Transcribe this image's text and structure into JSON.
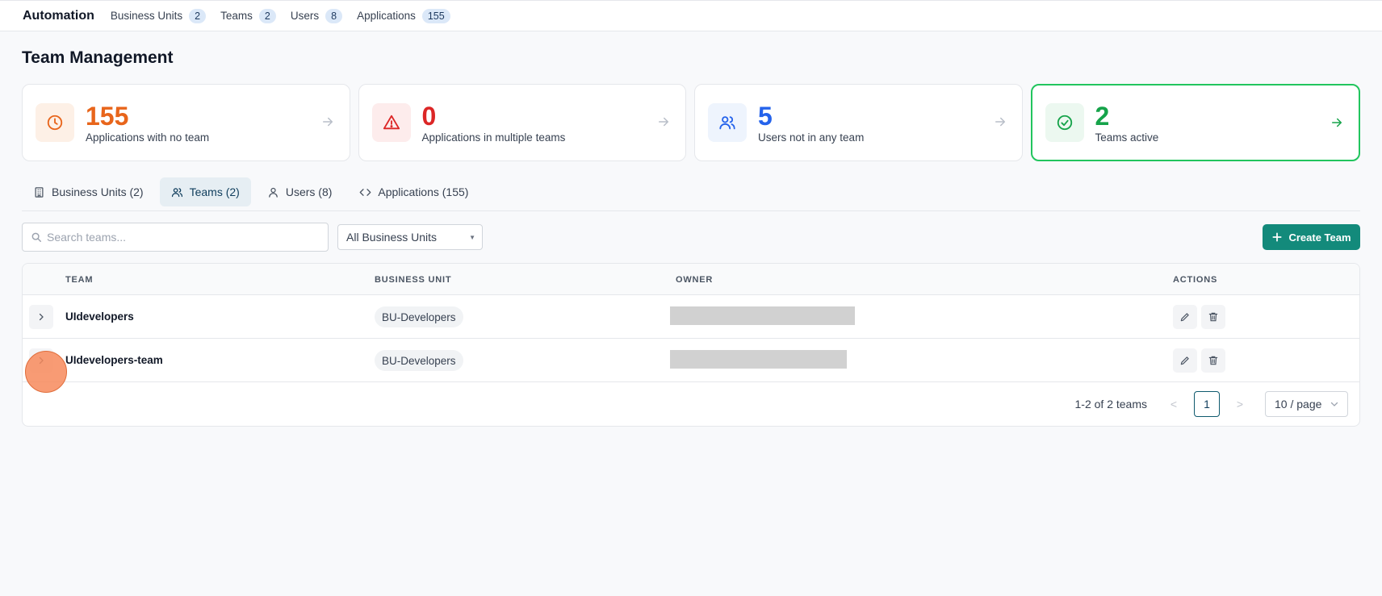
{
  "topbar": {
    "brand": "Automation",
    "nav": [
      {
        "label": "Business Units",
        "count": "2"
      },
      {
        "label": "Teams",
        "count": "2"
      },
      {
        "label": "Users",
        "count": "8"
      },
      {
        "label": "Applications",
        "count": "155"
      }
    ]
  },
  "page": {
    "title": "Team Management"
  },
  "stats": [
    {
      "value": "155",
      "label": "Applications with no team",
      "icon": "clock-icon",
      "color": "#e8651b",
      "bg": "#fdf0e6"
    },
    {
      "value": "0",
      "label": "Applications in multiple teams",
      "icon": "warning-icon",
      "color": "#dc2626",
      "bg": "#fdecec"
    },
    {
      "value": "5",
      "label": "Users not in any team",
      "icon": "users-icon",
      "color": "#2563eb",
      "bg": "#eef4fd"
    },
    {
      "value": "2",
      "label": "Teams active",
      "icon": "check-circle-icon",
      "color": "#16a34a",
      "bg": "#ecf8f0"
    }
  ],
  "tabs": [
    {
      "label": "Business Units (2)",
      "icon": "building-icon"
    },
    {
      "label": "Teams (2)",
      "icon": "users-icon"
    },
    {
      "label": "Users (8)",
      "icon": "user-icon"
    },
    {
      "label": "Applications (155)",
      "icon": "code-icon"
    }
  ],
  "filters": {
    "search_placeholder": "Search teams...",
    "bu_select": "All Business Units",
    "create_label": "Create Team"
  },
  "table": {
    "columns": {
      "team": "TEAM",
      "bu": "BUSINESS UNIT",
      "owner": "OWNER",
      "actions": "ACTIONS"
    },
    "rows": [
      {
        "team": "UIdevelopers",
        "bu": "BU-Developers"
      },
      {
        "team": "UIdevelopers-team",
        "bu": "BU-Developers"
      }
    ]
  },
  "pagination": {
    "summary": "1-2 of 2 teams",
    "page": "1",
    "page_size": "10 / page"
  }
}
